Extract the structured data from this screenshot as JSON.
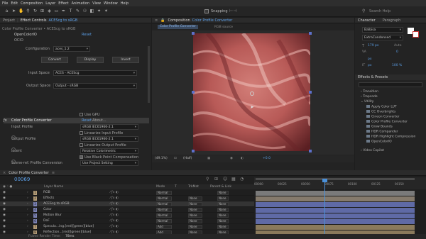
{
  "menu": [
    "File",
    "Edit",
    "Composition",
    "Layer",
    "Effect",
    "Animation",
    "View",
    "Window",
    "Help"
  ],
  "toolbar": {
    "snapping_label": "Snapping",
    "search_placeholder": "Search Help"
  },
  "left_panel": {
    "tab_project": "Project",
    "tab_effect_controls": "Effect Controls",
    "tab_target": "ACEScg to sRGB",
    "breadcrumb": "Color Profile Converter • ACEScg to sRGB",
    "effect1": {
      "name": "OpenColorIO",
      "reset": "Reset",
      "sub": "OCIO",
      "config_label": "Configuration",
      "config_value": "aces_1.2",
      "convert_btn": "Convert",
      "display_btn": "Display",
      "invert_btn": "Invert",
      "input_label": "Input Space",
      "input_value": "ACES - ACEScg",
      "output_label": "Output Space",
      "output_value": "Output - sRGB"
    },
    "use_gpu": "Use GPU",
    "effect2": {
      "name": "Color Profile Converter",
      "reset": "Reset",
      "about": "About...",
      "input_profile_label": "Input Profile",
      "input_profile_value": "sRGB IEC61966-2.1",
      "linearize_input": "Linearize Input Profile",
      "output_profile_label": "Output Profile",
      "output_profile_value": "sRGB IEC61966-2.1",
      "linearize_output": "Linearize Output Profile",
      "intent_label": "Intent",
      "intent_value": "Relative Colorimetric",
      "blackpoint": "Use Black Point Compensation",
      "scene_ref_label": "Scene-ref. Profile Conversion",
      "scene_ref_value": "Use Project Setting"
    }
  },
  "comp_panel": {
    "tab_label": "Composition",
    "comp_name": "Color Profile Converter",
    "breadcrumb_comp": "Color Profile Converter",
    "breadcrumb_layer": "RGB source",
    "zoom": "(49.1%)",
    "quality": "(Half)",
    "exposure": "+0.0"
  },
  "right_panel": {
    "tab_character": "Character",
    "tab_paragraph": "Paragraph",
    "font_name": "Balbisa",
    "font_style": "ExtraCondensed",
    "font_size": "179 px",
    "leading_label": "Auto",
    "tracking": "0",
    "px1": "px",
    "px2": "px",
    "pct": "100 %",
    "effects_title": "Effects & Presets",
    "categories": [
      "Transition",
      "Trapcode",
      "Utility"
    ],
    "utility_items": [
      "Apply Color LUT",
      "CC Overbrights",
      "Cineon Converter",
      "Color Profile Converter",
      "Grow Bounds",
      "HDR Compander",
      "HDR Highlight Compression",
      "OpenColorIO"
    ],
    "last_category": "Video Copilot"
  },
  "timeline": {
    "tab_label": "Color Profile Converter",
    "timecode": "00069",
    "col_layer_name": "Layer Name",
    "col_mode": "Mode",
    "col_t": "T",
    "col_trkmat": "TrkMat",
    "col_parent": "Parent & Link",
    "ruler_labels": [
      "00000",
      "00025",
      "00050",
      "00075",
      "00100",
      "00125",
      "00150"
    ],
    "footer_label": "Frame Render Time:",
    "footer_value": "78ms",
    "layers": [
      {
        "num": "1",
        "name": "RGB",
        "mode": "Normal",
        "trk": "",
        "parent": "None",
        "color": "#b49c77",
        "bar": "#7a7a7a"
      },
      {
        "num": "2",
        "name": "Effects",
        "mode": "Normal",
        "trk": "None",
        "parent": "None",
        "color": "#b49c77",
        "bar": "#857a6c"
      },
      {
        "num": "3",
        "name": "ACEScg to sRGB",
        "mode": "Normal",
        "trk": "None",
        "parent": "None",
        "color": "#7c83b6",
        "bar": "#5f6aa6"
      },
      {
        "num": "4",
        "name": "Color",
        "mode": "Normal",
        "trk": "None",
        "parent": "None",
        "color": "#7c83b6",
        "bar": "#5f6aa6"
      },
      {
        "num": "5",
        "name": "Motion Blur",
        "mode": "Normal",
        "trk": "None",
        "parent": "None",
        "color": "#7c83b6",
        "bar": "#5f6aa6"
      },
      {
        "num": "6",
        "name": "DoF",
        "mode": "Normal",
        "trk": "None",
        "parent": "None",
        "color": "#7c83b6",
        "bar": "#5f6aa6"
      },
      {
        "num": "7",
        "name": "Specula...ing.[red][green][blue]",
        "mode": "Add",
        "trk": "None",
        "parent": "None",
        "color": "#b49c77",
        "bar": "#8a7a5c"
      },
      {
        "num": "8",
        "name": "Reflection...[red][green][blue]",
        "mode": "Add",
        "trk": "None",
        "parent": "None",
        "color": "#b49c77",
        "bar": "#8a7a5c"
      }
    ]
  },
  "colors": {
    "accent": "#5b9ee6",
    "playhead": "#4a90d9"
  }
}
